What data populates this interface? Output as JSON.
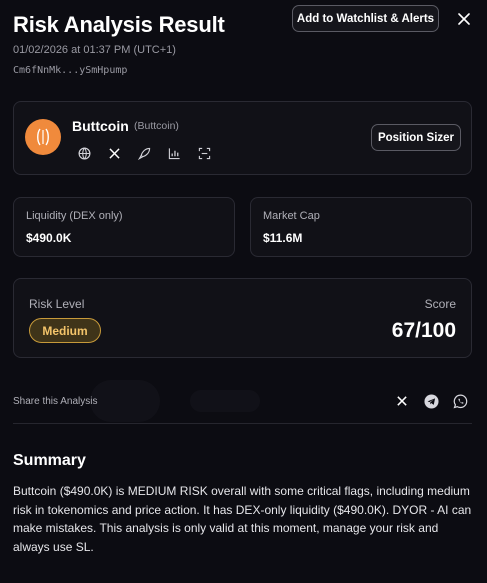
{
  "header": {
    "title": "Risk Analysis Result",
    "watchlist_button": "Add to Watchlist & Alerts",
    "close_icon": "close-icon",
    "timestamp": "01/02/2026 at 01:37 PM (UTC+1)",
    "address": "Cm6fNnMk...ySmHpump"
  },
  "token": {
    "name": "Buttcoin",
    "symbol": "(Buttcoin)",
    "logo_color": "#f08a3c",
    "icons": [
      "globe-icon",
      "x-icon",
      "rocket-icon",
      "chart-icon",
      "scan-icon"
    ],
    "position_sizer_button": "Position Sizer"
  },
  "stats": {
    "liquidity": {
      "label": "Liquidity (DEX only)",
      "value": "$490.0K"
    },
    "market_cap": {
      "label": "Market Cap",
      "value": "$11.6M"
    }
  },
  "risk": {
    "label": "Risk Level",
    "level": "Medium",
    "level_color": "#f3c46a",
    "score_label": "Score",
    "score": "67/100"
  },
  "share": {
    "label": "Share this Analysis",
    "icons": [
      "x-icon",
      "telegram-icon",
      "whatsapp-icon"
    ]
  },
  "summary": {
    "title": "Summary",
    "text": "Buttcoin ($490.0K) is MEDIUM RISK overall with some critical flags, including medium risk in tokenomics and price action. It has DEX-only liquidity ($490.0K). DYOR - AI can make mistakes. This analysis is only valid at this moment, manage your risk and always use SL."
  },
  "colors": {
    "background": "#0c0c12",
    "card": "#111117",
    "border": "#2a2a33"
  }
}
